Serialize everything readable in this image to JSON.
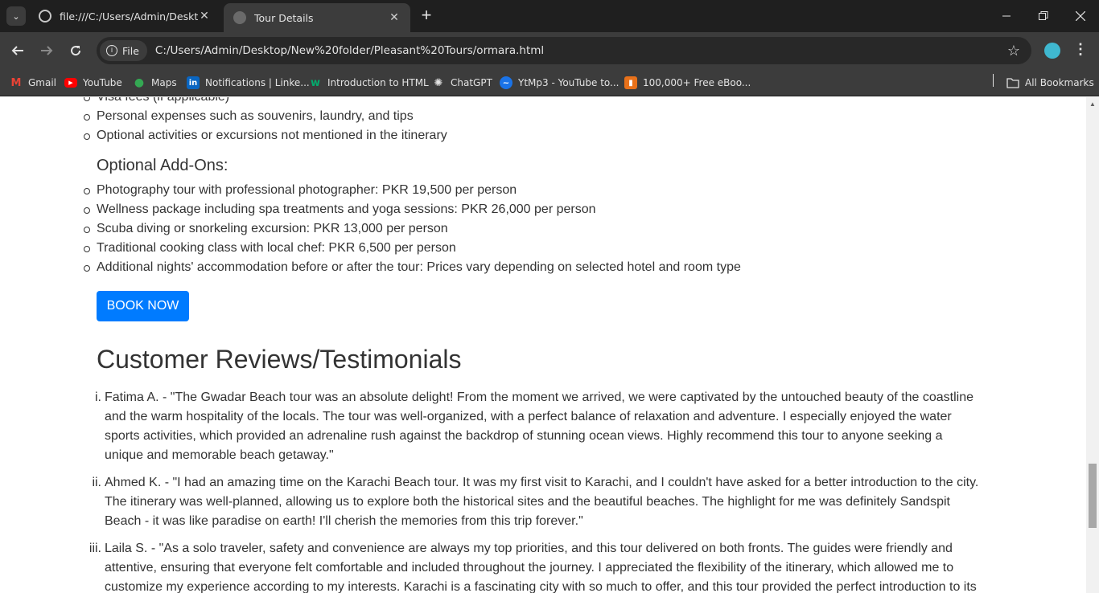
{
  "browser": {
    "tabs": [
      {
        "title": "file:///C:/Users/Admin/Desktop/",
        "active": false
      },
      {
        "title": "Tour Details",
        "active": true
      }
    ],
    "chip_label": "File",
    "url": "C:/Users/Admin/Desktop/New%20folder/Pleasant%20Tours/ormara.html",
    "bookmarks": [
      {
        "label": "Gmail",
        "icon": "gmail-icon"
      },
      {
        "label": "YouTube",
        "icon": "youtube-icon"
      },
      {
        "label": "Maps",
        "icon": "maps-icon"
      },
      {
        "label": "Notifications | Linke...",
        "icon": "linkedin-icon"
      },
      {
        "label": "Introduction to HTML",
        "icon": "w3schools-icon"
      },
      {
        "label": "ChatGPT",
        "icon": "chatgpt-icon"
      },
      {
        "label": "YtMp3 - YouTube to...",
        "icon": "ytmp3-icon"
      },
      {
        "label": "100,000+ Free eBoo...",
        "icon": "ebook-icon"
      }
    ],
    "all_bookmarks": "All Bookmarks"
  },
  "page": {
    "excluded_partial": "Visa fees (if applicable)",
    "excluded": [
      "Personal expenses such as souvenirs, laundry, and tips",
      "Optional activities or excursions not mentioned in the itinerary"
    ],
    "addons_heading": "Optional Add-Ons:",
    "addons": [
      "Photography tour with professional photographer: PKR 19,500 per person",
      "Wellness package including spa treatments and yoga sessions: PKR 26,000 per person",
      "Scuba diving or snorkeling excursion: PKR 13,000 per person",
      "Traditional cooking class with local chef: PKR 6,500 per person",
      "Additional nights' accommodation before or after the tour: Prices vary depending on selected hotel and room type"
    ],
    "book_button": "BOOK NOW",
    "reviews_heading": "Customer Reviews/Testimonials",
    "reviews": [
      {
        "num": "i.",
        "text": "Fatima A. - \"The Gwadar Beach tour was an absolute delight! From the moment we arrived, we were captivated by the untouched beauty of the coastline and the warm hospitality of the locals. The tour was well-organized, with a perfect balance of relaxation and adventure. I especially enjoyed the water sports activities, which provided an adrenaline rush against the backdrop of stunning ocean views. Highly recommend this tour to anyone seeking a unique and memorable beach getaway.\""
      },
      {
        "num": "ii.",
        "text": "Ahmed K. - \"I had an amazing time on the Karachi Beach tour. It was my first visit to Karachi, and I couldn't have asked for a better introduction to the city. The itinerary was well-planned, allowing us to explore both the historical sites and the beautiful beaches. The highlight for me was definitely Sandspit Beach - it was like paradise on earth! I'll cherish the memories from this trip forever.\""
      },
      {
        "num": "iii.",
        "text": "Laila S. - \"As a solo traveler, safety and convenience are always my top priorities, and this tour delivered on both fronts. The guides were friendly and attentive, ensuring that everyone felt comfortable and included throughout the journey. I appreciated the flexibility of the itinerary, which allowed me to customize my experience according to my interests. Karachi is a fascinating city with so much to offer, and this tour provided the perfect introduction to its"
      }
    ]
  }
}
